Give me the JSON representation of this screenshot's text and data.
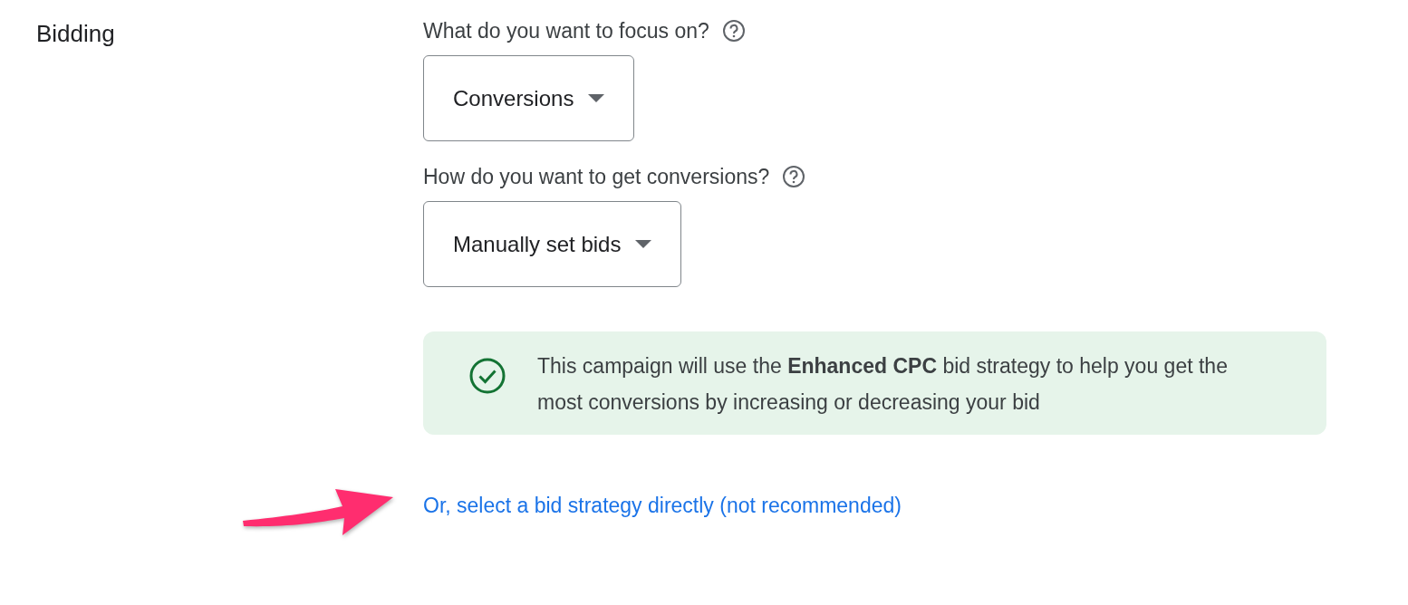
{
  "section": {
    "title": "Bidding"
  },
  "fields": [
    {
      "label": "What do you want to focus on?",
      "value": "Conversions"
    },
    {
      "label": "How do you want to get conversions?",
      "value": "Manually set bids"
    }
  ],
  "notice": {
    "text": "This campaign will use the **Enhanced CPC** bid strategy to help you get the most conversions by increasing or decreasing your bid"
  },
  "link": {
    "text": "Or, select a bid strategy directly (not recommended)"
  }
}
